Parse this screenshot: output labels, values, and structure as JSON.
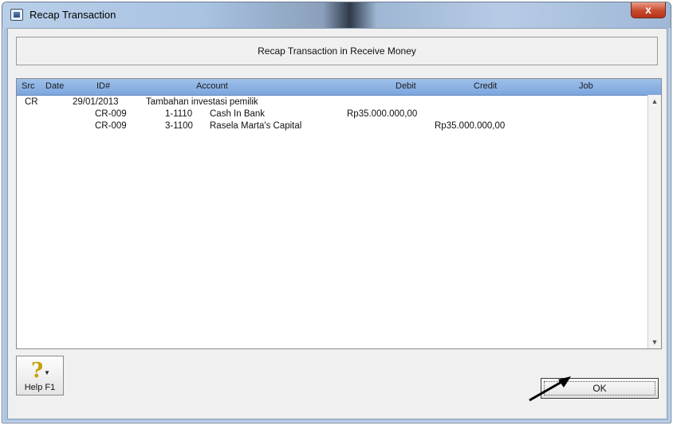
{
  "window": {
    "title": "Recap Transaction",
    "close_glyph": "x"
  },
  "heading": "Recap Transaction in Receive Money",
  "table": {
    "columns": {
      "src": "Src",
      "date": "Date",
      "id": "ID#",
      "account": "Account",
      "debit": "Debit",
      "credit": "Credit",
      "job": "Job"
    },
    "rows": [
      {
        "src": "CR",
        "date": "29/01/2013",
        "id": "",
        "account_no": "",
        "account_name": "Tambahan investasi pemilik",
        "debit": "",
        "credit": ""
      },
      {
        "src": "",
        "date": "",
        "id": "CR-009",
        "account_no": "1-1110",
        "account_name": "Cash In Bank",
        "debit": "Rp35.000.000,00",
        "credit": ""
      },
      {
        "src": "",
        "date": "",
        "id": "CR-009",
        "account_no": "3-1100",
        "account_name": "Rasela Marta's Capital",
        "debit": "",
        "credit": "Rp35.000.000,00"
      }
    ]
  },
  "help_button": {
    "label": "Help F1",
    "icon": "help-question-icon"
  },
  "ok_button": {
    "label": "OK"
  },
  "colors": {
    "header_blue": "#7ba6de",
    "window_border": "#6b7c93",
    "close_red": "#c84a2e"
  }
}
